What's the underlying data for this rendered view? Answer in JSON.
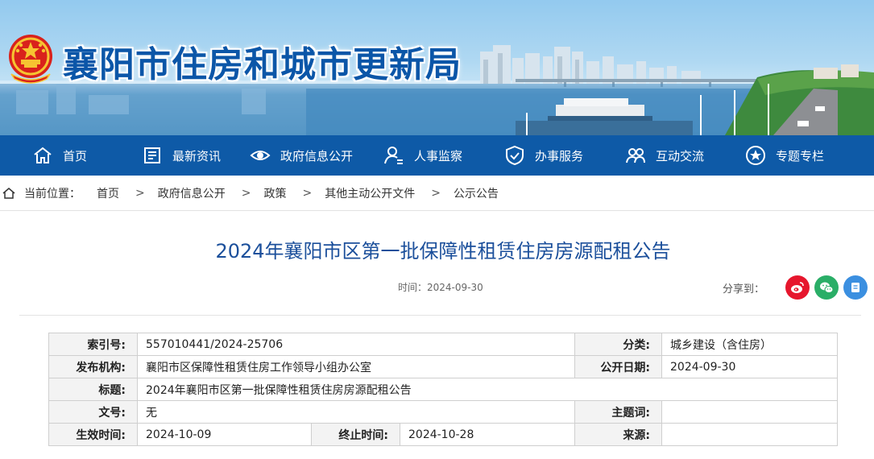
{
  "header": {
    "site_title": "襄阳市住房和城市更新局",
    "emblem_icon": "national-emblem-icon"
  },
  "nav": {
    "items": [
      {
        "label": "首页",
        "icon": "home-icon"
      },
      {
        "label": "最新资讯",
        "icon": "news-icon"
      },
      {
        "label": "政府信息公开",
        "icon": "eye-icon"
      },
      {
        "label": "人事监察",
        "icon": "person-icon"
      },
      {
        "label": "办事服务",
        "icon": "shield-icon"
      },
      {
        "label": "互动交流",
        "icon": "people-icon"
      },
      {
        "label": "专题专栏",
        "icon": "star-icon"
      }
    ]
  },
  "breadcrumb": {
    "prefix": "当前位置：",
    "items": [
      "首页",
      "政府信息公开",
      "政策",
      "其他主动公开文件",
      "公示公告"
    ],
    "separator": ">"
  },
  "article": {
    "title": "2024年襄阳市区第一批保障性租赁住房房源配租公告",
    "date_text": "时间：2024-09-30",
    "share_label": "分享到："
  },
  "share": {
    "buttons": [
      {
        "icon": "weibo-icon",
        "color": "#e6162d"
      },
      {
        "icon": "wechat-icon",
        "color": "#2aae67"
      },
      {
        "icon": "qzone-icon",
        "color": "#3b8fe0"
      }
    ]
  },
  "info": {
    "index_label": "索引号:",
    "index_value": "557010441/2024-25706",
    "category_label": "分类:",
    "category_value": "城乡建设（含住房）",
    "publisher_label": "发布机构:",
    "publisher_value": "襄阳市区保障性租赁住房工作领导小组办公室",
    "pubdate_label": "公开日期:",
    "pubdate_value": "2024-09-30",
    "title_label": "标题:",
    "title_value": "2024年襄阳市区第一批保障性租赁住房房源配租公告",
    "docno_label": "文号:",
    "docno_value": "无",
    "keywords_label": "主题词:",
    "keywords_value": "",
    "effective_label": "生效时间:",
    "effective_value": "2024-10-09",
    "end_label": "终止时间:",
    "end_value": "2024-10-28",
    "source_label": "来源:",
    "source_value": ""
  },
  "colors": {
    "nav_bg": "#0e5aa7",
    "title_blue": "#1b4f9b",
    "site_title_blue": "#0b56a8"
  }
}
